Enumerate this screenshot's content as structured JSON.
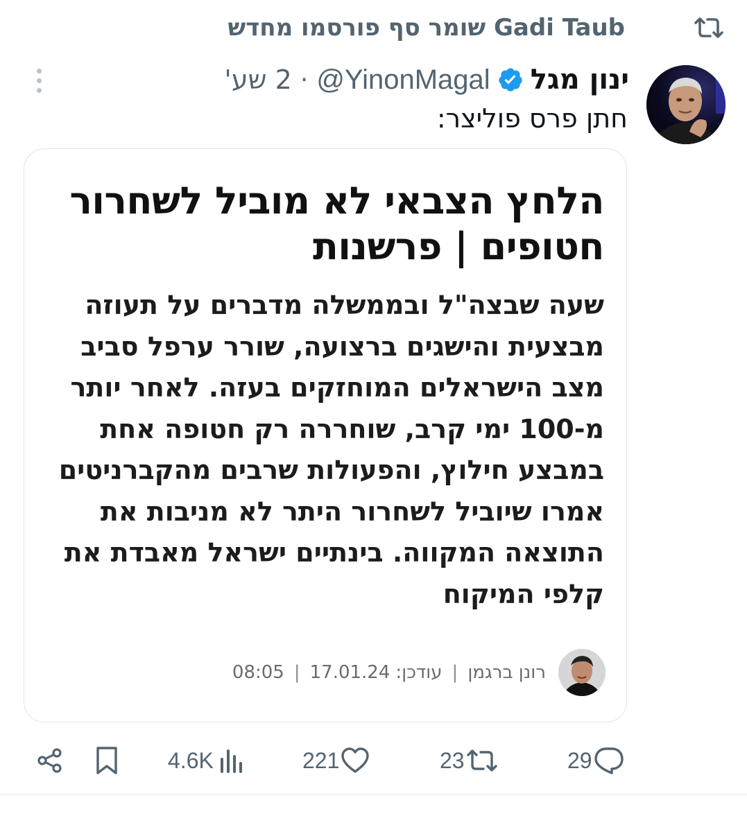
{
  "retweet_header": {
    "icon": "retweet-icon",
    "text": "Gadi Taub שומר סף פורסמו מחדש"
  },
  "tweet": {
    "avatar_icon": "avatar-yinon-magal",
    "author_name": "ינון מגל",
    "verified_icon": "verified-badge-icon",
    "handle": "@YinonMagal",
    "separator": "·",
    "time": "2 שע'",
    "more_icon": "more-options-icon",
    "text": "חתן פרס פוליצר:"
  },
  "card": {
    "headline": "הלחץ הצבאי לא מוביל לשחרור חטופים | פרשנות",
    "body": "שעה שבצה\"ל ובממשלה מדברים על תעוזה מבצעית והישגים ברצועה, שורר ערפל סביב מצב הישראלים המוחזקים בעזה. לאחר יותר מ-100 ימי קרב, שוחררה רק חטופה אחת במבצע חילוץ, והפעולות שרבים מהקברניטים אמרו שיוביל לשחרור היתר לא מניבות את התוצאה המקווה. בינתיים ישראל מאבדת את קלפי המיקוח",
    "reporter_avatar_icon": "reporter-avatar",
    "reporter": "רונן ברגמן",
    "sep1": "|",
    "updated_label": "עודכן:",
    "date": "17.01.24",
    "sep2": "|",
    "clock": "08:05"
  },
  "actions": {
    "replies": "29",
    "reposts": "23",
    "likes": "221",
    "views": "4.6K",
    "reply_icon": "reply-icon",
    "repost_icon": "retweet-icon",
    "like_icon": "heart-icon",
    "views_icon": "analytics-icon",
    "bookmark_icon": "bookmark-icon",
    "share_icon": "share-icon"
  },
  "colors": {
    "muted": "#536471",
    "verified_blue": "#1d9bf0",
    "text": "#0f1419",
    "card_border": "#dfe5ea"
  }
}
